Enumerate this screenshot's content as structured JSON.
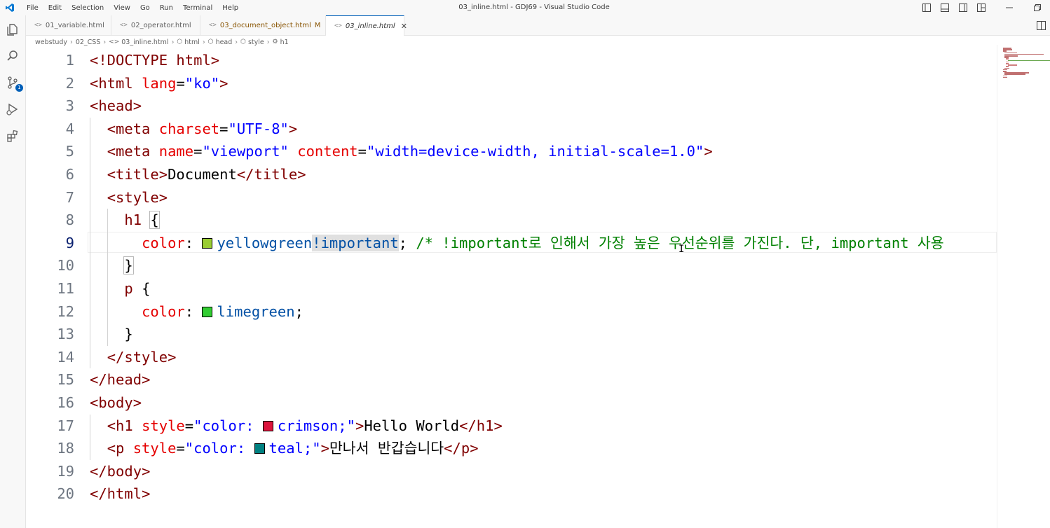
{
  "menu": [
    "File",
    "Edit",
    "Selection",
    "View",
    "Go",
    "Run",
    "Terminal",
    "Help"
  ],
  "window_title": "03_inline.html - GDJ69 - Visual Studio Code",
  "activity": {
    "scm_badge": "1"
  },
  "tabs": [
    {
      "label": "01_variable.html"
    },
    {
      "label": "02_operator.html"
    },
    {
      "label": "03_document_object.html",
      "flag": "M"
    },
    {
      "label": "03_inline.html",
      "close": "✕"
    }
  ],
  "breadcrumb": [
    "webstudy",
    "02_CSS",
    "03_inline.html",
    "html",
    "head",
    "style",
    "h1"
  ],
  "code_lines": [
    {
      "n": "1",
      "t": "<!DOCTYPE html>"
    },
    {
      "n": "2",
      "t": "<html lang=\"ko\">"
    },
    {
      "n": "3",
      "t": "<head>"
    },
    {
      "n": "4",
      "t": "  <meta charset=\"UTF-8\">"
    },
    {
      "n": "5",
      "t": "  <meta name=\"viewport\" content=\"width=device-width, initial-scale=1.0\">"
    },
    {
      "n": "6",
      "t": "  <title>Document</title>"
    },
    {
      "n": "7",
      "t": "  <style>"
    },
    {
      "n": "8",
      "t": "    h1 {"
    },
    {
      "n": "9",
      "t": "      color: yellowgreen!important; /* !important로 인해서 가장 높은 우선순위를 가진다. 단, important 사용"
    },
    {
      "n": "10",
      "t": "    }"
    },
    {
      "n": "11",
      "t": "    p {"
    },
    {
      "n": "12",
      "t": "      color: limegreen;"
    },
    {
      "n": "13",
      "t": "    }"
    },
    {
      "n": "14",
      "t": "  </style>"
    },
    {
      "n": "15",
      "t": "</head>"
    },
    {
      "n": "16",
      "t": "<body>"
    },
    {
      "n": "17",
      "t": "  <h1 style=\"color: crimson;\">Hello World</h1>"
    },
    {
      "n": "18",
      "t": "  <p style=\"color: teal;\">만나서 반갑습니다</p>"
    },
    {
      "n": "19",
      "t": "</body>"
    },
    {
      "n": "20",
      "t": "</html>"
    }
  ],
  "colors": {
    "accent": "#005fb8",
    "yellowgreen": "#9acd32",
    "limegreen": "#32cd32",
    "crimson": "#dc143c",
    "teal": "#008080"
  },
  "icons": [
    "vscode-logo",
    "explorer-icon",
    "search-icon",
    "source-control-icon",
    "run-debug-icon",
    "extensions-icon",
    "split-editor-icon"
  ]
}
